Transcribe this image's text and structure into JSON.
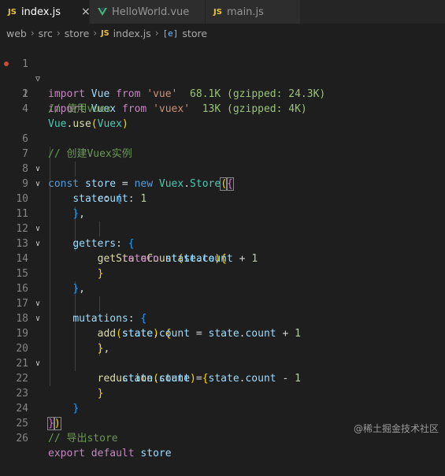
{
  "tabs": [
    {
      "icon": "JS",
      "label": "index.js",
      "close": "×"
    },
    {
      "label": "HelloWorld.vue"
    },
    {
      "icon": "JS",
      "label": "main.js"
    }
  ],
  "breadcrumb": {
    "segments": [
      "web",
      "src",
      "store"
    ],
    "file_icon": "JS",
    "file": "index.js",
    "symbol_icon": "[e]",
    "symbol": "store"
  },
  "lines": {
    "n1": "1",
    "n2": "1",
    "n3": "2",
    "n4": "4",
    "n6": "6",
    "n7": "7",
    "n8": "8",
    "n9": "9",
    "n10": "10",
    "n11": "11",
    "n12": "12",
    "n13": "13",
    "n14": "14",
    "n15": "15",
    "n16": "16",
    "n17": "17",
    "n18": "18",
    "n19": "19",
    "n20": "20",
    "n21": "21",
    "n22": "22",
    "n23": "23",
    "n24": "24",
    "n25": "25",
    "n26": "26"
  },
  "code": {
    "l1_import": "import",
    "l1_name": "Vue",
    "l1_from": "from",
    "l1_str": "'vue'",
    "l1_hint": "68.1K (gzipped: 24.3K)",
    "l2_import": "import",
    "l2_name": "Vuex",
    "l2_from": "from",
    "l2_str": "'vuex'",
    "l2_hint": "13K (gzipped: 4K)",
    "l3_comment": "// 使用vuex",
    "l4_obj": "Vue",
    "l4_fn": "use",
    "l4_arg": "Vuex",
    "l6_comment": "// 创建Vuex实例",
    "l7_const": "const",
    "l7_var": "store",
    "l7_new": "new",
    "l7_cls1": "Vuex",
    "l7_cls2": "Store",
    "l8_prop": "state",
    "l9_prop": "count",
    "l9_num": "1",
    "l11_prop": "getters",
    "l12_fn": "getStateCount",
    "l12_arg": "state",
    "l13_ret": "return",
    "l13_obj": "state",
    "l13_prop": "count",
    "l13_num": "1",
    "l16_prop": "mutations",
    "l17_fn": "add",
    "l17_arg": "state",
    "l18_obj1": "state",
    "l18_prop1": "count",
    "l18_obj2": "state",
    "l18_prop2": "count",
    "l18_num": "1",
    "l20_fn": "reduction",
    "l20_arg": "state",
    "l21_obj1": "state",
    "l21_prop1": "count",
    "l21_obj2": "state",
    "l21_prop2": "count",
    "l21_num": "1",
    "l25_comment": "// 导出store",
    "l26_export": "export",
    "l26_default": "default",
    "l26_var": "store"
  },
  "watermark": "@稀土掘金技术社区",
  "colors": {
    "keyword": "#c586c0",
    "string": "#ce9178",
    "comment": "#6a9955",
    "variable": "#9cdcfe",
    "function": "#dcdcaa",
    "class": "#4ec9b0",
    "number": "#b5cea8",
    "storage": "#569cd6"
  }
}
